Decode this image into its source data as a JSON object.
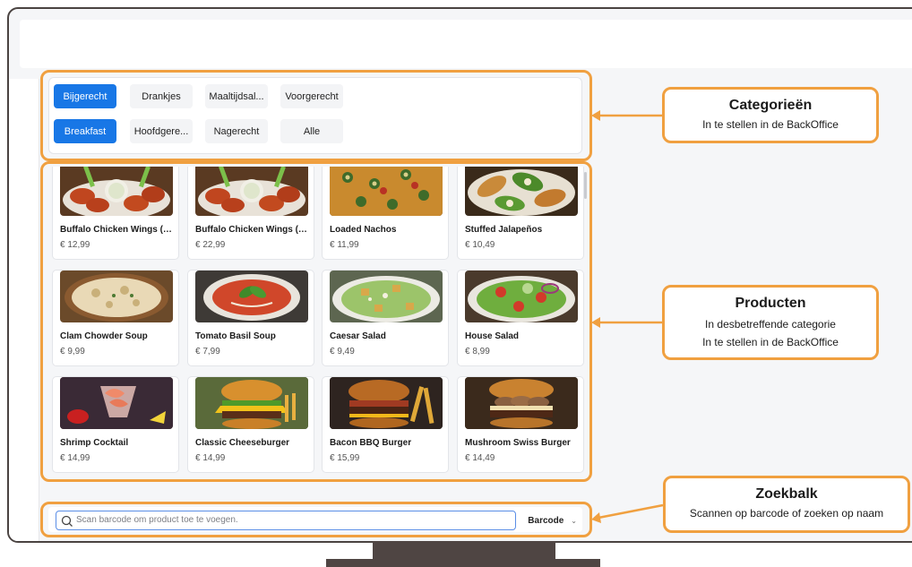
{
  "categories": {
    "row1": [
      {
        "label": "Bijgerecht",
        "active": true
      },
      {
        "label": "Drankjes",
        "active": false
      },
      {
        "label": "Maaltijdsal...",
        "active": false
      },
      {
        "label": "Voorgerecht",
        "active": false
      }
    ],
    "row2": [
      {
        "label": "Breakfast",
        "active": true
      },
      {
        "label": "Hoofdgere...",
        "active": false
      },
      {
        "label": "Nagerecht",
        "active": false
      },
      {
        "label": "Alle",
        "active": false
      }
    ]
  },
  "products": [
    {
      "name": "Buffalo Chicken Wings (6...",
      "price": "€ 12,99",
      "image": "chicken-wings"
    },
    {
      "name": "Buffalo Chicken Wings (1...",
      "price": "€ 22,99",
      "image": "chicken-wings"
    },
    {
      "name": "Loaded Nachos",
      "price": "€ 11,99",
      "image": "nachos"
    },
    {
      "name": "Stuffed Jalapeños",
      "price": "€ 10,49",
      "image": "jalapenos"
    },
    {
      "name": "Clam Chowder Soup",
      "price": "€ 9,99",
      "image": "chowder"
    },
    {
      "name": "Tomato Basil Soup",
      "price": "€ 7,99",
      "image": "tomato-soup"
    },
    {
      "name": "Caesar Salad",
      "price": "€ 9,49",
      "image": "caesar-salad"
    },
    {
      "name": "House Salad",
      "price": "€ 8,99",
      "image": "house-salad"
    },
    {
      "name": "Shrimp Cocktail",
      "price": "€ 14,99",
      "image": "shrimp-cocktail"
    },
    {
      "name": "Classic Cheeseburger",
      "price": "€ 14,99",
      "image": "cheeseburger"
    },
    {
      "name": "Bacon BBQ Burger",
      "price": "€ 15,99",
      "image": "bbq-burger"
    },
    {
      "name": "Mushroom Swiss Burger",
      "price": "€ 14,49",
      "image": "mushroom-burger"
    }
  ],
  "search": {
    "placeholder": "Scan barcode om product toe te voegen.",
    "mode": "Barcode"
  },
  "callouts": {
    "categories": {
      "title": "Categorieën",
      "lines": [
        "In te stellen in de BackOffice"
      ]
    },
    "products": {
      "title": "Producten",
      "lines": [
        "In desbetreffende categorie",
        "In te stellen in de BackOffice"
      ]
    },
    "search": {
      "title": "Zoekbalk",
      "lines": [
        "Scannen op barcode of zoeken op naam"
      ]
    }
  },
  "colors": {
    "accent": "#1877e6",
    "highlight": "#f0a040",
    "frame": "#4a4341"
  }
}
